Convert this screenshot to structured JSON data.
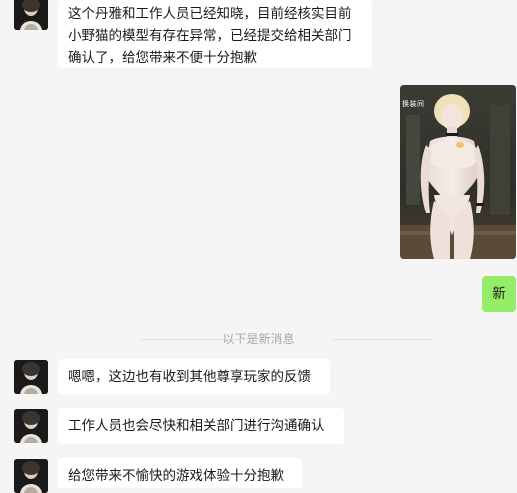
{
  "messages": [
    {
      "id": "m1",
      "sender": "other",
      "lines": [
        "这个丹雅和工作人员已经知晓，目前经核实目前",
        "小野猫的模型有存在异常，已经提交给相关部门",
        "确认了，给您带来不便十分抱歉"
      ]
    },
    {
      "id": "m2",
      "sender": "me",
      "type": "image",
      "image_caption": "换装间",
      "image_icon": "character-screenshot-image"
    },
    {
      "id": "m3",
      "sender": "me",
      "text": "新"
    },
    {
      "id": "m4",
      "sender": "other",
      "text": "嗯嗯，这边也有收到其他尊享玩家的反馈"
    },
    {
      "id": "m5",
      "sender": "other",
      "text": "工作人员也会尽快和相关部门进行沟通确认"
    },
    {
      "id": "m6",
      "sender": "other",
      "text": "给您带来不愉快的游戏体验十分抱歉"
    }
  ],
  "divider": {
    "text": "以下是新消息"
  },
  "colors": {
    "background": "#f5f5f5",
    "my_bubble": "#95ec69",
    "other_bubble": "#ffffff",
    "divider_text": "#a9a9a9"
  },
  "icons": {
    "avatar": "character-avatar-icon"
  }
}
